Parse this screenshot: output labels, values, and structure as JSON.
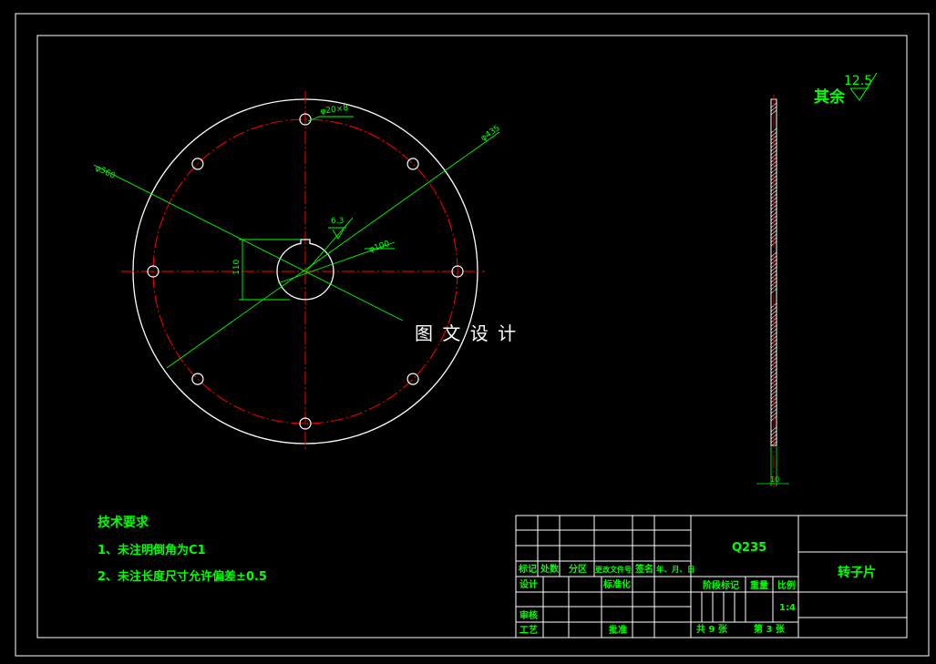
{
  "surface_roughness": {
    "prefix": "其余",
    "value": "12.5"
  },
  "dimensions": {
    "hole_pattern": "φ20×8",
    "outer_diameter": "φ560",
    "pitch_circle": "φ435",
    "bore_diameter": "φ100",
    "keyway_depth": "110",
    "bore_roughness": "6.3",
    "thickness": "10"
  },
  "watermark": "图 文 设 计",
  "tech_requirements": {
    "title": "技术要求",
    "items": [
      "1、未注明倒角为C1",
      "2、未注长度尺寸允许偏差±0.5"
    ]
  },
  "title_block": {
    "material": "Q235",
    "part_name": "转子片",
    "header_cells": [
      "标记",
      "处数",
      "分区",
      "更改文件号",
      "签名",
      "年、月、日"
    ],
    "design_label": "设计",
    "standardize_label": "标准化",
    "check_label": "审核",
    "process_label": "工艺",
    "approve_label": "批准",
    "stage_label": "阶段标记",
    "weight_label": "重量",
    "scale_label": "比例",
    "scale_value": "1:4",
    "sheets_total": "共 9 张",
    "sheet_number": "第 3 张"
  },
  "colors": {
    "outline": "#ffffff",
    "dimension": "#00ff00",
    "centerline": "#ff0000",
    "background": "#000000"
  }
}
